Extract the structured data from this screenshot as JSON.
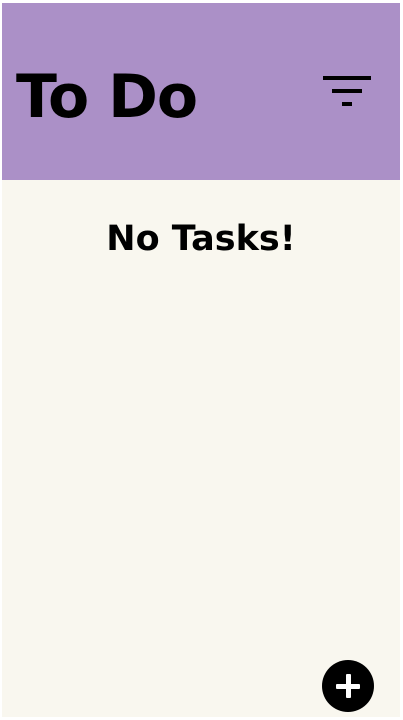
{
  "header": {
    "title": "To Do",
    "filter_icon": "filter-icon"
  },
  "main": {
    "empty_message": "No Tasks!"
  },
  "fab": {
    "icon": "plus-icon"
  },
  "colors": {
    "header_background": "#ab90c7",
    "page_background": "#f9f7ef",
    "text": "#000000",
    "fab_background": "#000000",
    "fab_icon": "#ffffff"
  }
}
